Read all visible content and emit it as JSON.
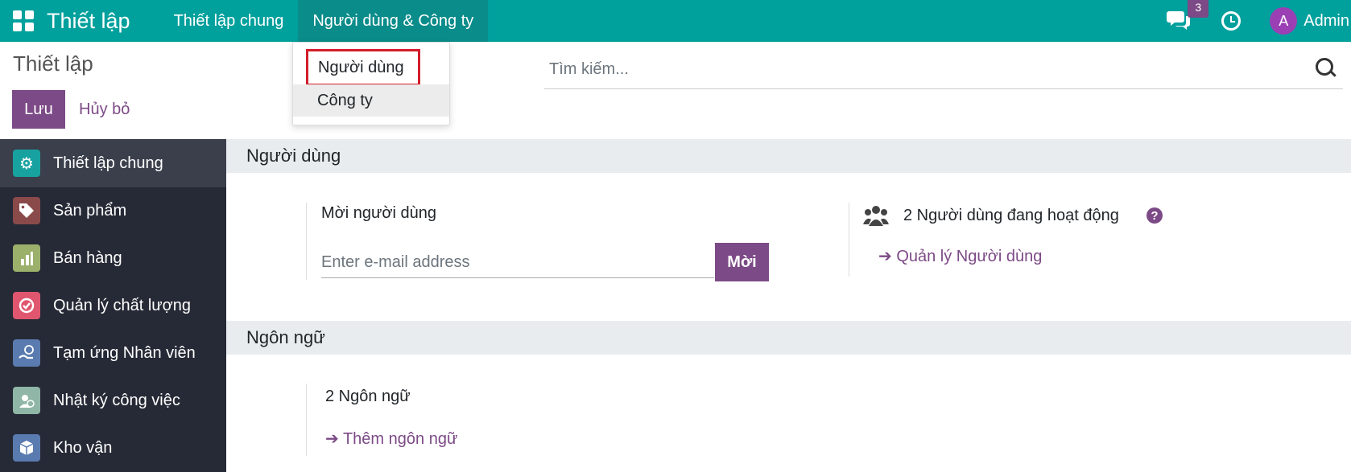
{
  "topbar": {
    "brand": "Thiết lập",
    "menu": [
      "Thiết lập chung",
      "Người dùng & Công ty"
    ],
    "chat_badge": "3",
    "avatar_letter": "A",
    "user": "Admin"
  },
  "control": {
    "breadcrumb": "Thiết lập",
    "save_label": "Lưu",
    "cancel_label": "Hủy bỏ",
    "search_placeholder": "Tìm kiếm..."
  },
  "dropdown": {
    "items": [
      "Người dùng",
      "Công ty"
    ]
  },
  "sidebar": {
    "items": [
      {
        "label": "Thiết lập chung",
        "icon": "gear-icon",
        "color": "#17a2a0",
        "glyph": "⚙"
      },
      {
        "label": "Sản phẩm",
        "icon": "tag-icon",
        "color": "#8a4a4a",
        "glyph": "🏷"
      },
      {
        "label": "Bán hàng",
        "icon": "sales-chart-icon",
        "color": "#9bb06a",
        "glyph": "▥"
      },
      {
        "label": "Quản lý chất lượng",
        "icon": "quality-check-icon",
        "color": "#e0566f",
        "glyph": "✓"
      },
      {
        "label": "Tạm ứng Nhân viên",
        "icon": "employee-advance-icon",
        "color": "#5a7bb0",
        "glyph": "$"
      },
      {
        "label": "Nhật ký công việc",
        "icon": "timesheet-icon",
        "color": "#8fb6a6",
        "glyph": "◷"
      },
      {
        "label": "Kho vận",
        "icon": "inventory-box-icon",
        "color": "#5a7bb0",
        "glyph": "▣"
      }
    ]
  },
  "users_section": {
    "title": "Người dùng",
    "invite_label": "Mời người dùng",
    "email_placeholder": "Enter e-mail address",
    "invite_button": "Mời",
    "active_users": "2 Người dùng đang hoạt động",
    "manage_link": "Quản lý Người dùng"
  },
  "language_section": {
    "title": "Ngôn ngữ",
    "count": "2 Ngôn ngữ",
    "add_link": "Thêm ngôn ngữ"
  }
}
